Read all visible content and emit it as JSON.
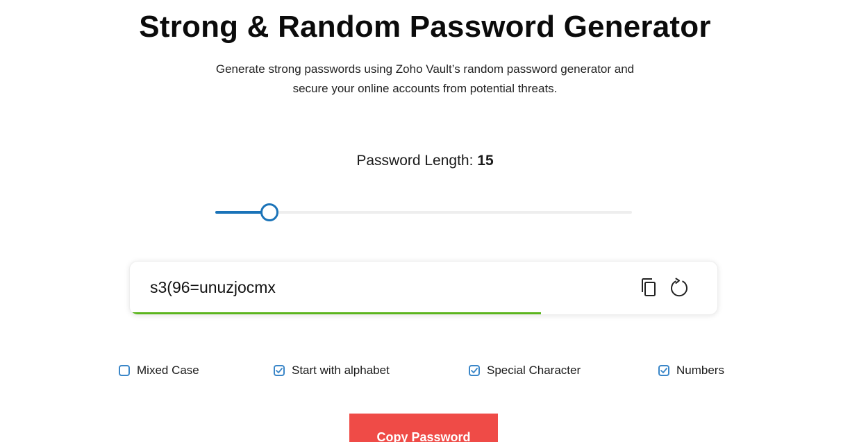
{
  "header": {
    "title": "Strong & Random Password Generator",
    "subtitle_line1": "Generate strong passwords using Zoho Vault’s random password generator and",
    "subtitle_line2": "secure your online accounts from potential threats."
  },
  "length": {
    "label": "Password Length:",
    "value": "15",
    "slider_fraction": 0.13
  },
  "password": {
    "value": "s3(96=unuzjocmx",
    "strength_fraction": 0.7,
    "copy_icon": "copy-icon",
    "refresh_icon": "refresh-icon"
  },
  "options": [
    {
      "label": "Mixed Case",
      "checked": false
    },
    {
      "label": "Start with alphabet",
      "checked": true
    },
    {
      "label": "Special Character",
      "checked": true
    },
    {
      "label": "Numbers",
      "checked": true
    }
  ],
  "actions": {
    "copy_label": "Copy Password"
  },
  "colors": {
    "accent": "#1a73b8",
    "strength": "#5cb51e",
    "button": "#ef4b47"
  }
}
